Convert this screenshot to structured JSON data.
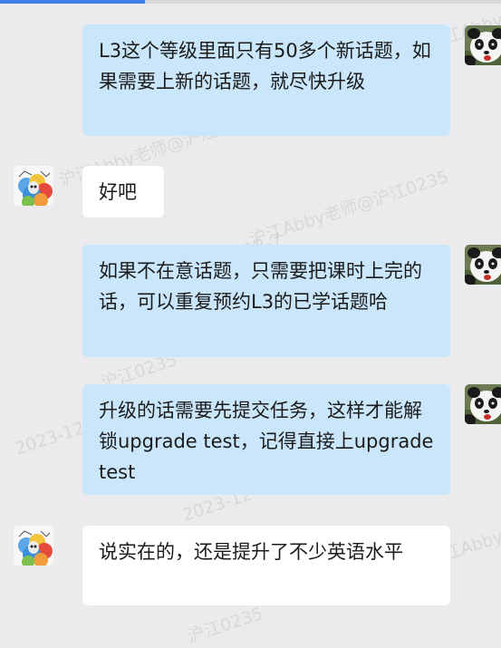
{
  "messages": [
    {
      "side": "out",
      "sender": "panda",
      "text": "L3这个等级里面只有50多个新话题，如果需要上新的话题，就尽快升级"
    },
    {
      "side": "in",
      "sender": "sheep",
      "text": "好吧"
    },
    {
      "side": "out",
      "sender": "panda",
      "text": "如果不在意话题，只需要把课时上完的话，可以重复预约L3的已学话题哈"
    },
    {
      "side": "out",
      "sender": "panda",
      "text": "升级的话需要先提交任务，这样才能解锁upgrade test，记得直接上upgrade test"
    },
    {
      "side": "in",
      "sender": "sheep",
      "text": "说实在的，还是提升了不少英语水平"
    }
  ],
  "watermark": {
    "line1": "沪江Abby老师@沪江0235",
    "line2": "2023-12-7",
    "fragments": [
      "沪江0235",
      "12-7",
      "2023-12-",
      "沪江Abby"
    ]
  },
  "colors": {
    "background": "#ebebed",
    "bubble_out": "#c9e6fb",
    "bubble_in": "#ffffff",
    "accent": "#3f7fe6"
  },
  "icons": {
    "panda_avatar": "panda-avatar-icon",
    "sheep_avatar": "sheep-avatar-icon"
  }
}
